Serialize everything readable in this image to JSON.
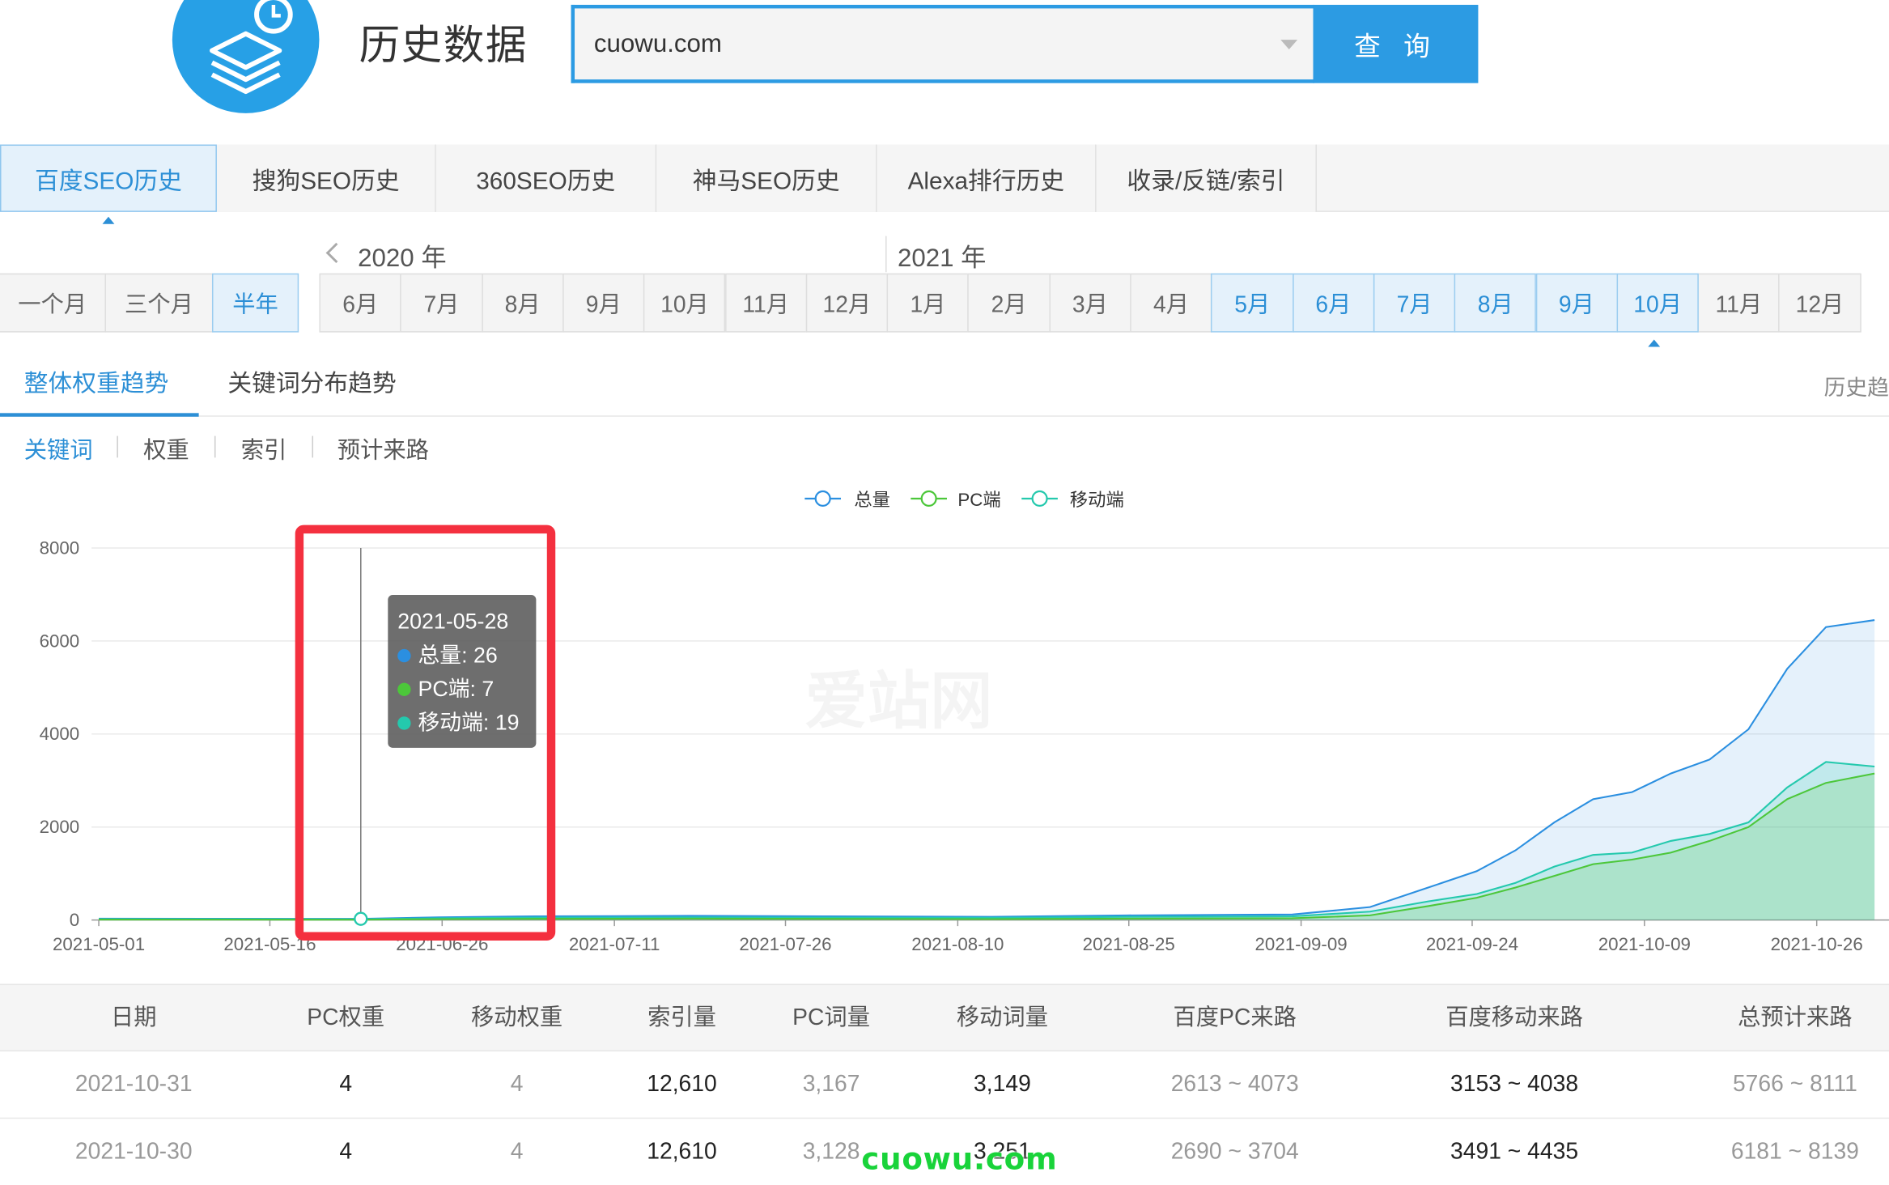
{
  "header": {
    "logo_icon": "stacked-layers-clock-icon",
    "title": "历史数据",
    "search": {
      "value": "cuowu.com",
      "placeholder": ""
    },
    "search_button": "查 询"
  },
  "engine_tabs": [
    {
      "label": "百度SEO历史",
      "active": true
    },
    {
      "label": "搜狗SEO历史",
      "active": false
    },
    {
      "label": "360SEO历史",
      "active": false
    },
    {
      "label": "神马SEO历史",
      "active": false
    },
    {
      "label": "Alexa排行历史",
      "active": false
    },
    {
      "label": "收录/反链/索引",
      "active": false
    }
  ],
  "periods": [
    {
      "label": "一个月",
      "selected": false
    },
    {
      "label": "三个月",
      "selected": false
    },
    {
      "label": "半年",
      "selected": true
    }
  ],
  "years": [
    "2020 年",
    "2021 年"
  ],
  "months": [
    {
      "label": "6月",
      "selected": false
    },
    {
      "label": "7月",
      "selected": false
    },
    {
      "label": "8月",
      "selected": false
    },
    {
      "label": "9月",
      "selected": false
    },
    {
      "label": "10月",
      "selected": false
    },
    {
      "label": "11月",
      "selected": false
    },
    {
      "label": "12月",
      "selected": false
    },
    {
      "label": "1月",
      "selected": false
    },
    {
      "label": "2月",
      "selected": false
    },
    {
      "label": "3月",
      "selected": false
    },
    {
      "label": "4月",
      "selected": false
    },
    {
      "label": "5月",
      "selected": true
    },
    {
      "label": "6月",
      "selected": true
    },
    {
      "label": "7月",
      "selected": true
    },
    {
      "label": "8月",
      "selected": true
    },
    {
      "label": "9月",
      "selected": true
    },
    {
      "label": "10月",
      "selected": true
    },
    {
      "label": "11月",
      "selected": false
    },
    {
      "label": "12月",
      "selected": false
    }
  ],
  "trend_tabs": [
    {
      "label": "整体权重趋势",
      "active": true
    },
    {
      "label": "关键词分布趋势",
      "active": false
    }
  ],
  "history_link": "历史趋",
  "metric_tabs": [
    {
      "label": "关键词",
      "active": true
    },
    {
      "label": "权重",
      "active": false
    },
    {
      "label": "索引",
      "active": false
    },
    {
      "label": "预计来路",
      "active": false
    }
  ],
  "watermark_text": "爱站网",
  "tooltip": {
    "date": "2021-05-28",
    "rows": [
      {
        "label": "总量: 26",
        "color": "#2b8fe0"
      },
      {
        "label": "PC端: 7",
        "color": "#4cc73a"
      },
      {
        "label": "移动端: 19",
        "color": "#24c9ad"
      }
    ]
  },
  "chart_data": {
    "type": "area",
    "legend_position": "top-center",
    "ylim": [
      0,
      8000
    ],
    "yticks": [
      "0",
      "2000",
      "4000",
      "6000",
      "8000"
    ],
    "xticks": [
      "2021-05-01",
      "2021-05-16",
      "2021-06-26",
      "2021-07-11",
      "2021-07-26",
      "2021-08-10",
      "2021-08-25",
      "2021-09-09",
      "2021-09-24",
      "2021-10-09",
      "2021-10-26"
    ],
    "grid": true,
    "x": [
      "2021-05-01",
      "2021-05-28",
      "2021-06-05",
      "2021-06-15",
      "2021-07-01",
      "2021-07-15",
      "2021-08-01",
      "2021-08-15",
      "2021-09-01",
      "2021-09-09",
      "2021-09-15",
      "2021-09-20",
      "2021-09-24",
      "2021-09-28",
      "2021-10-02",
      "2021-10-06",
      "2021-10-10",
      "2021-10-14",
      "2021-10-18",
      "2021-10-22",
      "2021-10-26",
      "2021-10-31"
    ],
    "series": [
      {
        "name": "总量",
        "color": "#2b8fe0",
        "values": [
          30,
          26,
          60,
          80,
          90,
          80,
          70,
          100,
          120,
          280,
          700,
          1050,
          1500,
          2100,
          2600,
          2750,
          3150,
          3450,
          4100,
          5400,
          6300,
          6450
        ]
      },
      {
        "name": "PC端",
        "color": "#4cc73a",
        "values": [
          10,
          7,
          20,
          25,
          30,
          25,
          20,
          30,
          40,
          100,
          300,
          480,
          700,
          950,
          1200,
          1300,
          1450,
          1700,
          2000,
          2600,
          2950,
          3150
        ]
      },
      {
        "name": "移动端",
        "color": "#24c9ad",
        "values": [
          20,
          19,
          40,
          55,
          60,
          55,
          50,
          70,
          80,
          180,
          400,
          560,
          800,
          1150,
          1400,
          1450,
          1700,
          1850,
          2100,
          2850,
          3400,
          3300
        ]
      }
    ]
  },
  "table": {
    "headers": [
      "日期",
      "PC权重",
      "移动权重",
      "索引量",
      "PC词量",
      "移动词量",
      "百度PC来路",
      "百度移动来路",
      "总预计来路"
    ],
    "rows": [
      [
        "2021-10-31",
        "4",
        "4",
        "12,610",
        "3,167",
        "3,149",
        "2613 ~ 4073",
        "3153 ~ 4038",
        "5766 ~ 8111"
      ],
      [
        "2021-10-30",
        "4",
        "4",
        "12,610",
        "3,128",
        "3,251",
        "2690 ~ 3704",
        "3491 ~ 4435",
        "6181 ~ 8139"
      ]
    ]
  },
  "site_watermark": "cuowu.com"
}
